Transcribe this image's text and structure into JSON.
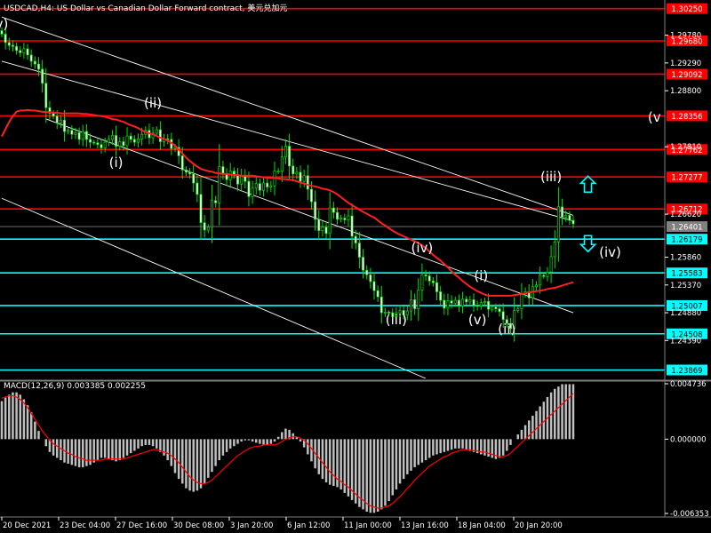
{
  "header": {
    "symbol_line": "USDCAD,H4: US Dollar vs Canadian Dollar Forward contract, 美元兑加元",
    "macd_line": "MACD(12,26,9) 0.003385 0.002255"
  },
  "chart_data": [
    {
      "type": "candlestick",
      "title": "USDCAD,H4",
      "ylim": [
        1.2372,
        1.3037
      ],
      "price_axis_labels": [
        1.2978,
        1.2929,
        1.288,
        1.2781,
        1.2662,
        1.2586,
        1.2537,
        1.2488,
        1.2439
      ],
      "current_price": {
        "label": "1.26401",
        "value": 1.26401
      },
      "resistance_levels": [
        {
          "label": "1.30250",
          "value": 1.3025,
          "color": "#ff0000"
        },
        {
          "label": "1.29680",
          "value": 1.2968,
          "color": "#ff0000"
        },
        {
          "label": "1.29092",
          "value": 1.29092,
          "color": "#ff0000"
        },
        {
          "label": "1.28356",
          "value": 1.28356,
          "color": "#ff0000"
        },
        {
          "label": "1.27762",
          "value": 1.27762,
          "color": "#ff0000"
        },
        {
          "label": "1.27277",
          "value": 1.27277,
          "color": "#ff0000"
        },
        {
          "label": "1.26712",
          "value": 1.26712,
          "color": "#ff0000"
        }
      ],
      "support_levels": [
        {
          "label": "1.26179",
          "value": 1.26179,
          "color": "#00ffff"
        },
        {
          "label": "1.25583",
          "value": 1.25583,
          "color": "#00ffff"
        },
        {
          "label": "1.25007",
          "value": 1.25007,
          "color": "#00ffff"
        },
        {
          "label": "1.24508",
          "value": 1.24508,
          "color": "#00ffff"
        },
        {
          "label": "1.23869",
          "value": 1.23869,
          "color": "#00ffff"
        }
      ],
      "x_tick_labels": [
        "20 Dec 2021",
        "23 Dec 04:00",
        "27 Dec 16:00",
        "30 Dec 08:00",
        "3 Jan 20:00",
        "6 Jan 12:00",
        "11 Jan 00:00",
        "13 Jan 16:00",
        "18 Jan 04:00",
        "20 Jan 20:00"
      ],
      "wave_labels": [
        {
          "text": "v)",
          "bar": 0,
          "price": 1.299
        },
        {
          "text": "(ii)",
          "bar": 41,
          "price": 1.285
        },
        {
          "text": "(i)",
          "bar": 31,
          "price": 1.2745
        },
        {
          "text": "(iii)",
          "bar": 107,
          "price": 1.2468
        },
        {
          "text": "(iv)",
          "bar": 114,
          "price": 1.2595
        },
        {
          "text": "(v)",
          "bar": 129,
          "price": 1.2468
        },
        {
          "text": "(i)",
          "bar": 130,
          "price": 1.2545
        },
        {
          "text": "(ii)",
          "bar": 137,
          "price": 1.2451
        },
        {
          "text": "(iii)",
          "bar": 149,
          "price": 1.272
        },
        {
          "text": "(iv)",
          "bar": 165,
          "price": 1.2587
        },
        {
          "text": "(v",
          "bar": 177,
          "price": 1.2825
        }
      ],
      "arrows": [
        {
          "direction": "up",
          "bar": 159,
          "price": 1.2715,
          "color": "#00ffff"
        },
        {
          "direction": "down",
          "bar": 159,
          "price": 1.261,
          "color": "#00ffff"
        }
      ],
      "channel_lines": [
        {
          "from": {
            "bar": 0,
            "price": 1.2932
          },
          "to": {
            "bar": 155,
            "price": 1.265
          }
        },
        {
          "from": {
            "bar": 0,
            "price": 1.301
          },
          "to": {
            "bar": 155,
            "price": 1.266
          }
        },
        {
          "from": {
            "bar": 0,
            "price": 1.269
          },
          "to": {
            "bar": 115,
            "price": 1.2372
          }
        },
        {
          "from": {
            "bar": 12,
            "price": 1.283
          },
          "to": {
            "bar": 155,
            "price": 1.2488
          }
        }
      ],
      "moving_average_color": "#ff2020",
      "close_series": [
        1.298,
        1.2965,
        1.296,
        1.2958,
        1.2951,
        1.2947,
        1.2954,
        1.2943,
        1.2932,
        1.2927,
        1.2918,
        1.2893,
        1.285,
        1.284,
        1.2835,
        1.2823,
        1.2828,
        1.2808,
        1.281,
        1.2803,
        1.2806,
        1.2794,
        1.2808,
        1.2794,
        1.2789,
        1.2788,
        1.2785,
        1.2779,
        1.2789,
        1.2794,
        1.2801,
        1.2782,
        1.279,
        1.2783,
        1.28,
        1.2794,
        1.2789,
        1.2795,
        1.2803,
        1.281,
        1.2797,
        1.2805,
        1.2811,
        1.279,
        1.2795,
        1.2794,
        1.2778,
        1.278,
        1.2765,
        1.274,
        1.2736,
        1.2733,
        1.2717,
        1.2697,
        1.2647,
        1.2634,
        1.2639,
        1.2686,
        1.2682,
        1.2746,
        1.2733,
        1.2723,
        1.2738,
        1.2731,
        1.2715,
        1.2729,
        1.272,
        1.2693,
        1.2708,
        1.2716,
        1.2704,
        1.2717,
        1.271,
        1.2712,
        1.2738,
        1.2738,
        1.2763,
        1.2782,
        1.2747,
        1.2733,
        1.2736,
        1.272,
        1.273,
        1.2706,
        1.2684,
        1.2653,
        1.2633,
        1.2639,
        1.2628,
        1.2673,
        1.2665,
        1.2653,
        1.2655,
        1.2652,
        1.2659,
        1.2623,
        1.2611,
        1.2586,
        1.2563,
        1.2555,
        1.2543,
        1.2527,
        1.2516,
        1.2488,
        1.2489,
        1.2488,
        1.2481,
        1.2488,
        1.2492,
        1.2484,
        1.2491,
        1.2511,
        1.2495,
        1.2528,
        1.2555,
        1.2553,
        1.2544,
        1.2541,
        1.2525,
        1.251,
        1.2496,
        1.2509,
        1.2505,
        1.251,
        1.25,
        1.2512,
        1.2507,
        1.2511,
        1.2501,
        1.25,
        1.2506,
        1.2508,
        1.2494,
        1.2498,
        1.2495,
        1.249,
        1.2476,
        1.2469,
        1.246,
        1.2492,
        1.2495,
        1.2522,
        1.2525,
        1.2514,
        1.2534,
        1.2537,
        1.2554,
        1.2552,
        1.256,
        1.2587,
        1.2613,
        1.2675,
        1.2657,
        1.266,
        1.2651,
        1.2645
      ],
      "ma_series": [
        1.2799,
        1.2812,
        1.2825,
        1.2835,
        1.2843,
        1.2845,
        1.2845,
        1.2846,
        1.2845,
        1.2845,
        1.2844,
        1.2843,
        1.2842,
        1.2842,
        1.2841,
        1.2841,
        1.284,
        1.284,
        1.284,
        1.284,
        1.284,
        1.284,
        1.2839,
        1.2839,
        1.2838,
        1.2837,
        1.2836,
        1.2835,
        1.2834,
        1.2832,
        1.283,
        1.2829,
        1.2827,
        1.2825,
        1.2822,
        1.2819,
        1.2817,
        1.2814,
        1.281,
        1.2807,
        1.2805,
        1.2803,
        1.28,
        1.2797,
        1.2795,
        1.2792,
        1.2788,
        1.2783,
        1.2776,
        1.2769,
        1.2762,
        1.2756,
        1.2751,
        1.2746,
        1.2742,
        1.274,
        1.2738,
        1.2737,
        1.2735,
        1.2734,
        1.2733,
        1.2733,
        1.2732,
        1.2731,
        1.2731,
        1.273,
        1.273,
        1.273,
        1.273,
        1.2729,
        1.2728,
        1.2727,
        1.2727,
        1.2726,
        1.2726,
        1.2725,
        1.2724,
        1.2724,
        1.2723,
        1.2722,
        1.272,
        1.2718,
        1.2716,
        1.2714,
        1.2712,
        1.2711,
        1.2709,
        1.2707,
        1.2706,
        1.2704,
        1.2701,
        1.2697,
        1.2692,
        1.2687,
        1.2682,
        1.2678,
        1.2674,
        1.267,
        1.2666,
        1.2663,
        1.2659,
        1.2656,
        1.2651,
        1.2646,
        1.2642,
        1.2637,
        1.2633,
        1.2629,
        1.2626,
        1.2623,
        1.262,
        1.2617,
        1.2614,
        1.2611,
        1.2607,
        1.2602,
        1.2596,
        1.259,
        1.2585,
        1.258,
        1.2574,
        1.2568,
        1.2561,
        1.2555,
        1.255,
        1.2544,
        1.2539,
        1.2534,
        1.253,
        1.2526,
        1.2523,
        1.252,
        1.2518,
        1.2518,
        1.2518,
        1.2518,
        1.2518,
        1.2518,
        1.2518,
        1.2519,
        1.252,
        1.2521,
        1.2522,
        1.2524,
        1.2525,
        1.2526,
        1.2527,
        1.2528,
        1.253,
        1.2531,
        1.2532,
        1.2534,
        1.2536,
        1.2538,
        1.254,
        1.2542
      ]
    },
    {
      "type": "macd",
      "title": "MACD(12,26,9)",
      "ylim": [
        -0.006353,
        0.004736
      ],
      "axis_labels": [
        {
          "label": "0.004736",
          "value": 0.004736
        },
        {
          "label": "0.000000",
          "value": 0.0
        },
        {
          "label": "-0.006353",
          "value": -0.006353
        }
      ],
      "histogram_color": "#c0c0c0",
      "signal_color": "#ff0000",
      "histogram": [
        0.00325,
        0.00355,
        0.0038,
        0.004,
        0.004,
        0.0038,
        0.0034,
        0.0029,
        0.0023,
        0.0015,
        0.0007,
        0.0,
        -0.0006,
        -0.0011,
        -0.0014,
        -0.0016,
        -0.0018,
        -0.002,
        -0.0021,
        -0.0022,
        -0.0023,
        -0.0024,
        -0.0024,
        -0.0023,
        -0.0022,
        -0.002,
        -0.0018,
        -0.0016,
        -0.0016,
        -0.0017,
        -0.0018,
        -0.0019,
        -0.0018,
        -0.0016,
        -0.0014,
        -0.0012,
        -0.001,
        -0.0008,
        -0.0006,
        -0.0005,
        -0.0005,
        -0.0006,
        -0.0008,
        -0.0011,
        -0.0014,
        -0.0018,
        -0.0023,
        -0.0029,
        -0.0034,
        -0.0038,
        -0.0042,
        -0.0044,
        -0.0045,
        -0.0044,
        -0.0042,
        -0.0038,
        -0.0033,
        -0.0028,
        -0.0023,
        -0.0018,
        -0.0014,
        -0.0011,
        -0.0008,
        -0.0006,
        -0.0004,
        -0.0002,
        -0.0001,
        -0.0001,
        -0.0002,
        -0.0003,
        -0.0004,
        -0.0005,
        -0.0005,
        -0.0004,
        -0.0002,
        0.0002,
        0.0006,
        0.0009,
        0.0008,
        0.0005,
        0.0002,
        -0.0002,
        -0.0007,
        -0.0013,
        -0.0019,
        -0.0025,
        -0.003,
        -0.0034,
        -0.0037,
        -0.0039,
        -0.004,
        -0.0041,
        -0.0043,
        -0.0046,
        -0.0049,
        -0.0052,
        -0.0055,
        -0.0058,
        -0.006,
        -0.0062,
        -0.0063,
        -0.0063,
        -0.0062,
        -0.006,
        -0.0057,
        -0.0053,
        -0.0048,
        -0.0043,
        -0.0038,
        -0.0034,
        -0.003,
        -0.0027,
        -0.0024,
        -0.0022,
        -0.002,
        -0.0018,
        -0.0016,
        -0.0014,
        -0.0013,
        -0.0012,
        -0.0011,
        -0.001,
        -0.0009,
        -0.0008,
        -0.0008,
        -0.0008,
        -0.0009,
        -0.001,
        -0.0011,
        -0.0012,
        -0.0013,
        -0.0014,
        -0.0015,
        -0.0016,
        -0.0017,
        -0.0016,
        -0.0014,
        -0.001,
        -0.0005,
        0.0,
        0.0004,
        0.0008,
        0.0012,
        0.0016,
        0.002,
        0.0024,
        0.0028,
        0.0032,
        0.0036,
        0.004,
        0.0043,
        0.0045,
        0.0047,
        0.0047,
        0.0047,
        0.0047
      ],
      "signal": [
        0.0035,
        0.0036,
        0.0037,
        0.0037,
        0.0036,
        0.0034,
        0.0031,
        0.0027,
        0.0022,
        0.0017,
        0.0012,
        0.0007,
        0.0003,
        -0.0001,
        -0.0004,
        -0.0006,
        -0.0008,
        -0.001,
        -0.0012,
        -0.0013,
        -0.0015,
        -0.0016,
        -0.0017,
        -0.0018,
        -0.0018,
        -0.0018,
        -0.0018,
        -0.0018,
        -0.0017,
        -0.0017,
        -0.0017,
        -0.0017,
        -0.0017,
        -0.0017,
        -0.0016,
        -0.0015,
        -0.0014,
        -0.0013,
        -0.0012,
        -0.0011,
        -0.001,
        -0.0009,
        -0.0009,
        -0.001,
        -0.0011,
        -0.0012,
        -0.0014,
        -0.0017,
        -0.002,
        -0.0024,
        -0.0028,
        -0.0032,
        -0.0035,
        -0.0037,
        -0.0038,
        -0.0038,
        -0.0037,
        -0.0035,
        -0.0032,
        -0.0029,
        -0.0026,
        -0.0023,
        -0.002,
        -0.0017,
        -0.0014,
        -0.0012,
        -0.001,
        -0.0008,
        -0.0007,
        -0.0006,
        -0.0006,
        -0.0005,
        -0.0005,
        -0.0005,
        -0.0005,
        -0.0004,
        -0.0002,
        0.0,
        0.0001,
        0.0002,
        0.0002,
        0.0001,
        -0.0001,
        -0.0004,
        -0.0008,
        -0.0012,
        -0.0016,
        -0.002,
        -0.0024,
        -0.0028,
        -0.0031,
        -0.0034,
        -0.0036,
        -0.0039,
        -0.0041,
        -0.0044,
        -0.0047,
        -0.005,
        -0.0052,
        -0.0055,
        -0.0057,
        -0.0058,
        -0.0059,
        -0.0059,
        -0.0058,
        -0.0057,
        -0.0055,
        -0.0052,
        -0.0049,
        -0.0046,
        -0.0042,
        -0.0039,
        -0.0035,
        -0.0032,
        -0.0029,
        -0.0026,
        -0.0023,
        -0.0021,
        -0.0019,
        -0.0017,
        -0.0015,
        -0.0014,
        -0.0012,
        -0.0011,
        -0.001,
        -0.0009,
        -0.0009,
        -0.0009,
        -0.001,
        -0.001,
        -0.0011,
        -0.0011,
        -0.0012,
        -0.0013,
        -0.0014,
        -0.0015,
        -0.0015,
        -0.0014,
        -0.0012,
        -0.0009,
        -0.0006,
        -0.0003,
        0.0,
        0.0003,
        0.0006,
        0.0009,
        0.0012,
        0.0015,
        0.0018,
        0.0021,
        0.0024,
        0.0027,
        0.003,
        0.0033,
        0.0036,
        0.0039
      ]
    }
  ]
}
